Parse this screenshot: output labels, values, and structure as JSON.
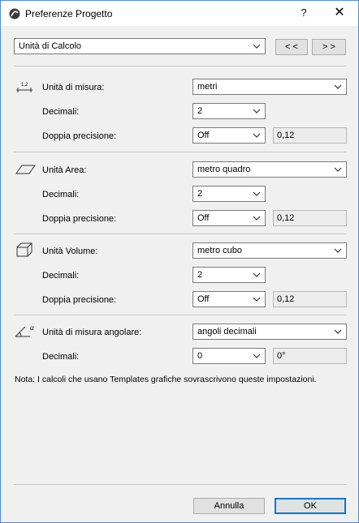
{
  "window": {
    "title": "Preferenze Progetto",
    "help_label": "?",
    "close_label": "✕"
  },
  "top": {
    "page_select": "Unità di Calcolo",
    "prev_label": "< <",
    "next_label": "> >"
  },
  "length": {
    "label": "Unità di misura:",
    "unit": "metri",
    "decimals_label": "Decimali:",
    "decimals": "2",
    "double_label": "Doppia precisione:",
    "double": "Off",
    "preview": "0,12"
  },
  "area": {
    "label": "Unità Area:",
    "unit": "metro quadro",
    "decimals_label": "Decimali:",
    "decimals": "2",
    "double_label": "Doppia precisione:",
    "double": "Off",
    "preview": "0,12"
  },
  "volume": {
    "label": "Unità Volume:",
    "unit": "metro cubo",
    "decimals_label": "Decimali:",
    "decimals": "2",
    "double_label": "Doppia precisione:",
    "double": "Off",
    "preview": "0,12"
  },
  "angle": {
    "label": "Unità di misura angolare:",
    "unit": "angoli decimali",
    "decimals_label": "Decimali:",
    "decimals": "0",
    "preview": "0°"
  },
  "length_icon_text": "1,2",
  "angle_icon_text": "α",
  "note": "Nota: I calcoli che usano Templates grafiche sovrascrivono queste impostazioni.",
  "footer": {
    "cancel_label": "Annulla",
    "ok_label": "OK"
  }
}
